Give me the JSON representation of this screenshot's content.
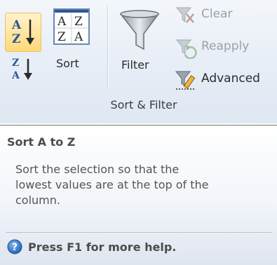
{
  "ribbon": {
    "group_title": "Sort & Filter",
    "buttons": {
      "sort_ascending": {
        "icon": "sort-az-icon",
        "state": "hover"
      },
      "sort_descending": {
        "icon": "sort-za-icon"
      },
      "sort": {
        "label": "Sort",
        "icon": "sort-dialog-icon"
      },
      "filter": {
        "label": "Filter",
        "icon": "funnel-icon"
      },
      "clear": {
        "label": "Clear",
        "icon": "clear-filter-icon",
        "state": "disabled"
      },
      "reapply": {
        "label": "Reapply",
        "icon": "reapply-icon",
        "state": "disabled"
      },
      "advanced": {
        "label": "Advanced",
        "icon": "advanced-filter-icon"
      }
    }
  },
  "tooltip": {
    "title": "Sort A to Z",
    "description_lines": [
      "Sort the selection so that the",
      "lowest values are at the top of the",
      "column."
    ],
    "help_text": "Press F1 for more help.",
    "help_icon": "help-icon"
  },
  "colors": {
    "ribbon_background": "#e7edf6",
    "hover_highlight": "#ffd978",
    "icon_blue": "#2f5597",
    "tooltip_border": "#767676"
  }
}
